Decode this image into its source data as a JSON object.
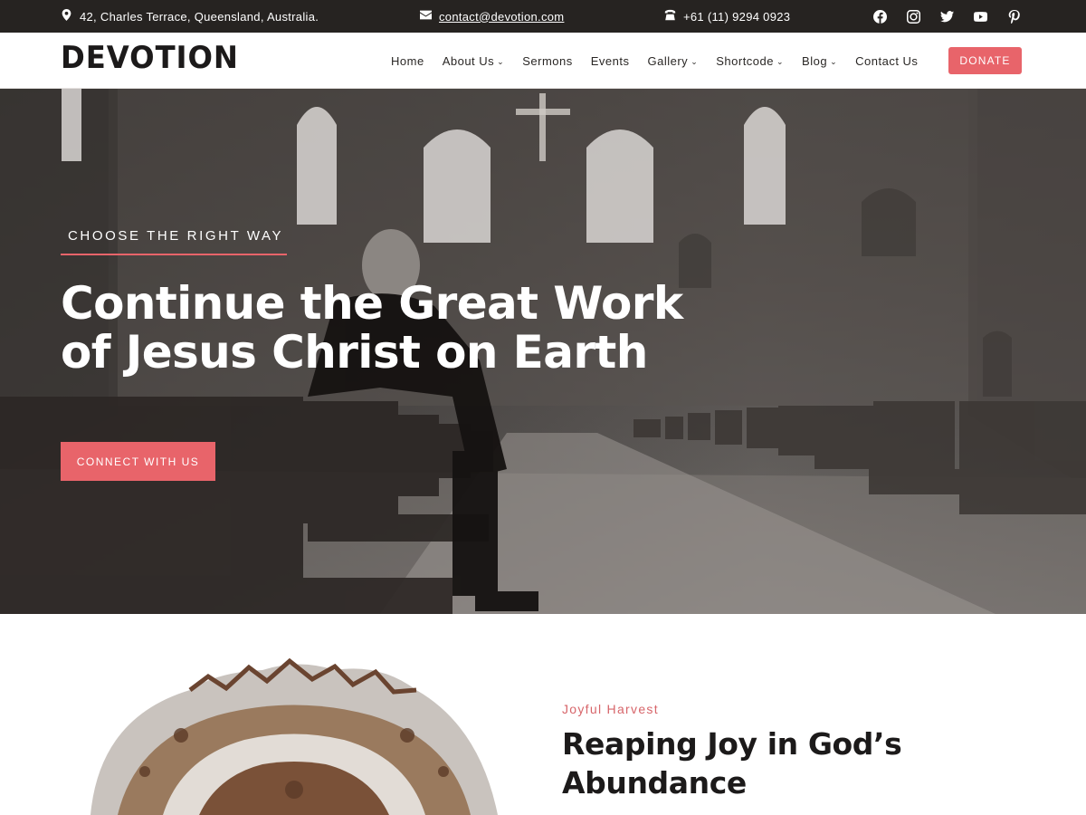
{
  "topbar": {
    "address": "42, Charles Terrace, Queensland, Australia.",
    "email": "contact@devotion.com",
    "phone": "+61 (11) 9294 0923",
    "social": [
      "facebook-icon",
      "instagram-icon",
      "twitter-icon",
      "youtube-icon",
      "pinterest-icon"
    ]
  },
  "header": {
    "logo": "DEVOTION",
    "nav": [
      {
        "label": "Home",
        "dropdown": false
      },
      {
        "label": "About Us",
        "dropdown": true
      },
      {
        "label": "Sermons",
        "dropdown": false
      },
      {
        "label": "Events",
        "dropdown": false
      },
      {
        "label": "Gallery",
        "dropdown": true
      },
      {
        "label": "Shortcode",
        "dropdown": true
      },
      {
        "label": "Blog",
        "dropdown": true
      },
      {
        "label": "Contact Us",
        "dropdown": false
      }
    ],
    "donate_label": "DONATE"
  },
  "hero": {
    "kicker": "CHOOSE THE RIGHT WAY",
    "headline_line1": "Continue the Great Work",
    "headline_line2": "of Jesus Christ on Earth",
    "cta_label": "CONNECT WITH US"
  },
  "feature": {
    "tag": "Joyful Harvest",
    "title_line1": "Reaping Joy in God’s",
    "title_line2": "Abundance"
  },
  "colors": {
    "accent": "#e8646a",
    "topbar_bg": "#262321",
    "text_dark": "#1c1a1a"
  }
}
